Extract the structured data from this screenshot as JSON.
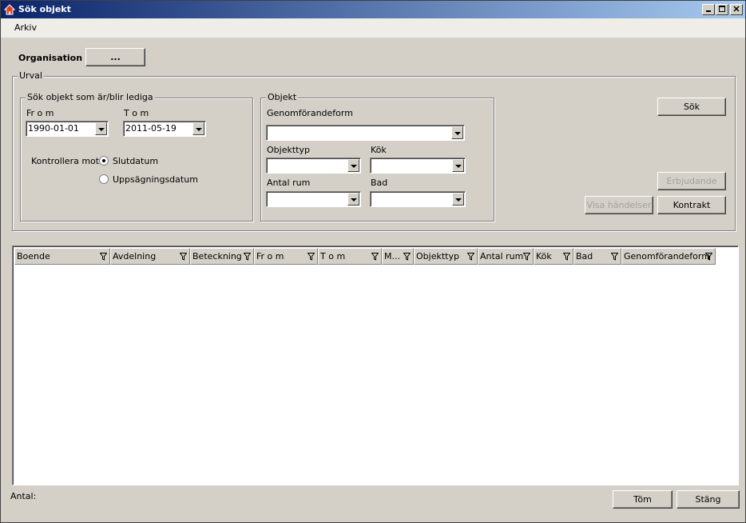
{
  "window": {
    "title": "Sök objekt"
  },
  "menu": {
    "items": [
      "Arkiv"
    ]
  },
  "organisation": {
    "label": "Organisation",
    "button_label": "..."
  },
  "urval": {
    "legend": "Urval",
    "period": {
      "legend": "Sök objekt som är/blir lediga",
      "from_label": "Fr o m",
      "from_value": "1990-01-01",
      "to_label": "T o m",
      "to_value": "2011-05-19",
      "check_against_label": "Kontrollera mot",
      "options": [
        {
          "label": "Slutdatum",
          "checked": true
        },
        {
          "label": "Uppsägningsdatum",
          "checked": false
        }
      ]
    },
    "objekt": {
      "legend": "Objekt",
      "genomforandeform_label": "Genomförandeform",
      "genomforandeform_value": "",
      "objekttyp_label": "Objekttyp",
      "objekttyp_value": "",
      "kok_label": "Kök",
      "kok_value": "",
      "antal_rum_label": "Antal rum",
      "antal_rum_value": "",
      "bad_label": "Bad",
      "bad_value": ""
    }
  },
  "actions": {
    "sok": "Sök",
    "erbjudande": "Erbjudande",
    "visa_handelser": "Visa händelser",
    "kontrakt": "Kontrakt"
  },
  "grid": {
    "columns": [
      "Boende",
      "Avdelning",
      "Beteckning",
      "Fr o m",
      "T o m",
      "M...",
      "Objekttyp",
      "Antal rum",
      "Kök",
      "Bad",
      "Genomförandeform"
    ],
    "rows": []
  },
  "footer": {
    "count_label": "Antal:",
    "tom_button": "Töm",
    "stang_button": "Stäng"
  }
}
